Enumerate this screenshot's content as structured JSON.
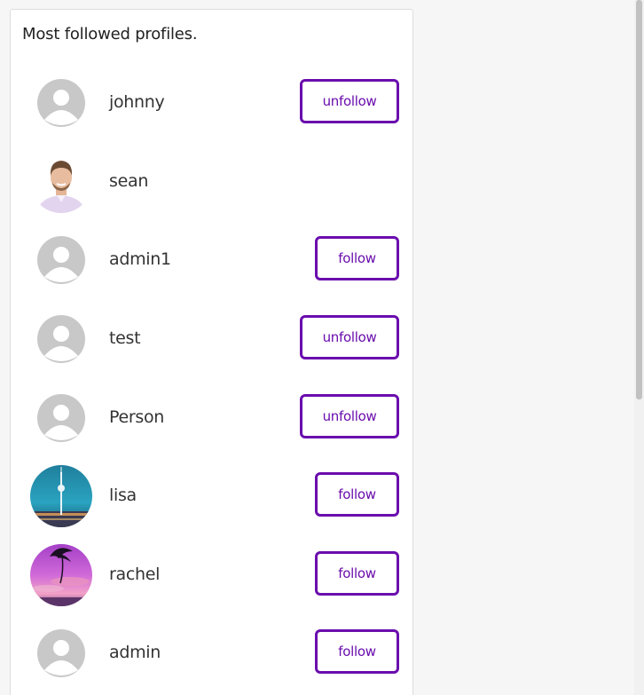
{
  "card": {
    "title": "Most followed profiles."
  },
  "profiles": [
    {
      "username": "johnny",
      "avatar": "default-avatar-icon",
      "action": "unfollow"
    },
    {
      "username": "sean",
      "avatar": "man-photo-avatar",
      "action": ""
    },
    {
      "username": "admin1",
      "avatar": "default-avatar-icon",
      "action": "follow"
    },
    {
      "username": "test",
      "avatar": "default-avatar-icon",
      "action": "unfollow"
    },
    {
      "username": "Person",
      "avatar": "default-avatar-icon",
      "action": "unfollow"
    },
    {
      "username": "lisa",
      "avatar": "tv-tower-photo-avatar",
      "action": "follow"
    },
    {
      "username": "rachel",
      "avatar": "purple-sunset-photo-avatar",
      "action": "follow"
    },
    {
      "username": "admin",
      "avatar": "default-avatar-icon",
      "action": "follow"
    }
  ],
  "colors": {
    "accent": "#6a0dad",
    "page_background": "#f6f6f6",
    "card_background": "#ffffff",
    "default_avatar_bg": "#c8c8c8"
  }
}
